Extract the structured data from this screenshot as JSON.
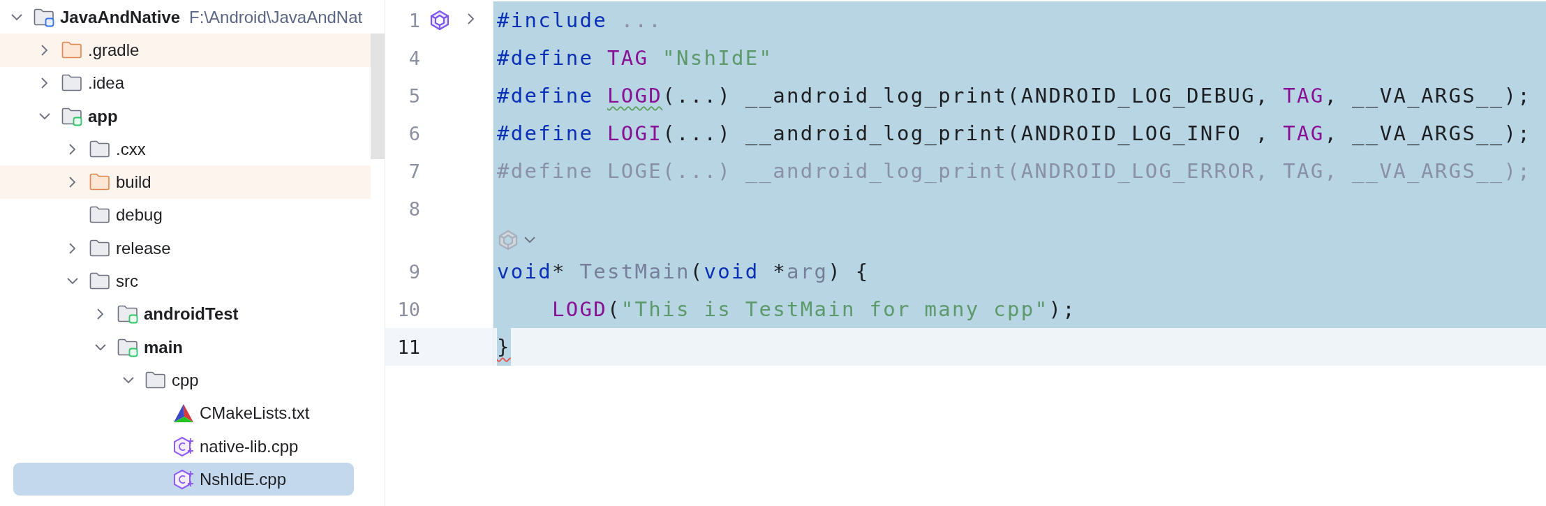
{
  "tree": [
    {
      "label": "JavaAndNative",
      "hint": "F:\\Android\\JavaAndNat",
      "kind": "project",
      "expanded": true,
      "selected": false,
      "children": [
        {
          "label": ".gradle",
          "kind": "excluded",
          "expanded": false,
          "selected": false
        },
        {
          "label": ".idea",
          "kind": "folder",
          "expanded": false,
          "selected": false
        },
        {
          "label": "app",
          "kind": "module",
          "expanded": true,
          "selected": false,
          "children": [
            {
              "label": ".cxx",
              "kind": "folder",
              "expanded": false,
              "selected": false
            },
            {
              "label": "build",
              "kind": "excluded",
              "expanded": false,
              "selected": false
            },
            {
              "label": "debug",
              "kind": "folder",
              "selected": false
            },
            {
              "label": "release",
              "kind": "folder",
              "expanded": false,
              "selected": false
            },
            {
              "label": "src",
              "kind": "folder",
              "expanded": true,
              "selected": false,
              "children": [
                {
                  "label": "androidTest",
                  "kind": "module",
                  "expanded": false,
                  "selected": false
                },
                {
                  "label": "main",
                  "kind": "module",
                  "expanded": true,
                  "selected": false,
                  "children": [
                    {
                      "label": "cpp",
                      "kind": "folder",
                      "expanded": true,
                      "selected": false,
                      "children": [
                        {
                          "label": "CMakeLists.txt",
                          "kind": "cmake",
                          "selected": false
                        },
                        {
                          "label": "native-lib.cpp",
                          "kind": "cpp",
                          "selected": false
                        },
                        {
                          "label": "NshIdE.cpp",
                          "kind": "cpp",
                          "selected": true
                        }
                      ]
                    }
                  ]
                }
              ]
            }
          ]
        }
      ]
    }
  ],
  "editor": {
    "lines": [
      {
        "kind": "code",
        "number": "1",
        "gutter_action": true,
        "folded": true,
        "selected": true,
        "tokens": [
          {
            "kind": "keyword",
            "text": "#include"
          },
          {
            "kind": "folded",
            "text": " ..."
          }
        ]
      },
      {
        "kind": "code",
        "number": "4",
        "selected": true,
        "tokens": [
          {
            "kind": "keyword",
            "text": "#define "
          },
          {
            "kind": "macro",
            "text": "TAG"
          },
          {
            "kind": "string",
            "text": " \"NshIdE\""
          }
        ]
      },
      {
        "kind": "code",
        "number": "5",
        "selected": true,
        "tokens": [
          {
            "kind": "keyword",
            "text": "#define "
          },
          {
            "kind": "macro",
            "text": "LOGD",
            "warning": true
          },
          {
            "kind": "plain",
            "text": "(...) __android_log_print(ANDROID_LOG_DEBUG, "
          },
          {
            "kind": "macro",
            "text": "TAG"
          },
          {
            "kind": "plain",
            "text": ", __VA_ARGS__);"
          }
        ]
      },
      {
        "kind": "code",
        "number": "6",
        "selected": true,
        "tokens": [
          {
            "kind": "keyword",
            "text": "#define "
          },
          {
            "kind": "macro",
            "text": "LOGI"
          },
          {
            "kind": "plain",
            "text": "(...) __android_log_print(ANDROID_LOG_INFO , "
          },
          {
            "kind": "macro",
            "text": "TAG"
          },
          {
            "kind": "plain",
            "text": ", __VA_ARGS__);"
          }
        ]
      },
      {
        "kind": "code",
        "number": "7",
        "selected": true,
        "tokens": [
          {
            "kind": "inactive",
            "text": "#define LOGE(...) __android_log_print(ANDROID_LOG_ERROR, TAG, __VA_ARGS__);"
          }
        ]
      },
      {
        "kind": "code",
        "number": "8",
        "selected": true
      },
      {
        "kind": "inlay",
        "selected": true
      },
      {
        "kind": "code",
        "number": "9",
        "selected": true,
        "tokens": [
          {
            "kind": "keyword",
            "text": "void"
          },
          {
            "kind": "plain",
            "text": "* "
          },
          {
            "kind": "function",
            "text": "TestMain"
          },
          {
            "kind": "plain",
            "text": "("
          },
          {
            "kind": "keyword",
            "text": "void"
          },
          {
            "kind": "plain",
            "text": " *"
          },
          {
            "kind": "parameter",
            "text": "arg"
          },
          {
            "kind": "plain",
            "text": ") {"
          }
        ]
      },
      {
        "kind": "code",
        "number": "10",
        "selected": true,
        "tokens": [
          {
            "kind": "macro",
            "text": "    LOGD"
          },
          {
            "kind": "plain",
            "text": "("
          },
          {
            "kind": "string",
            "text": "\"This is TestMain for many cpp\""
          },
          {
            "kind": "plain",
            "text": ");"
          }
        ]
      },
      {
        "kind": "code",
        "number": "11",
        "selected": false,
        "current": true,
        "tokens": [
          {
            "kind": "plain",
            "text": "}",
            "error": true,
            "selected": true
          }
        ]
      }
    ]
  }
}
